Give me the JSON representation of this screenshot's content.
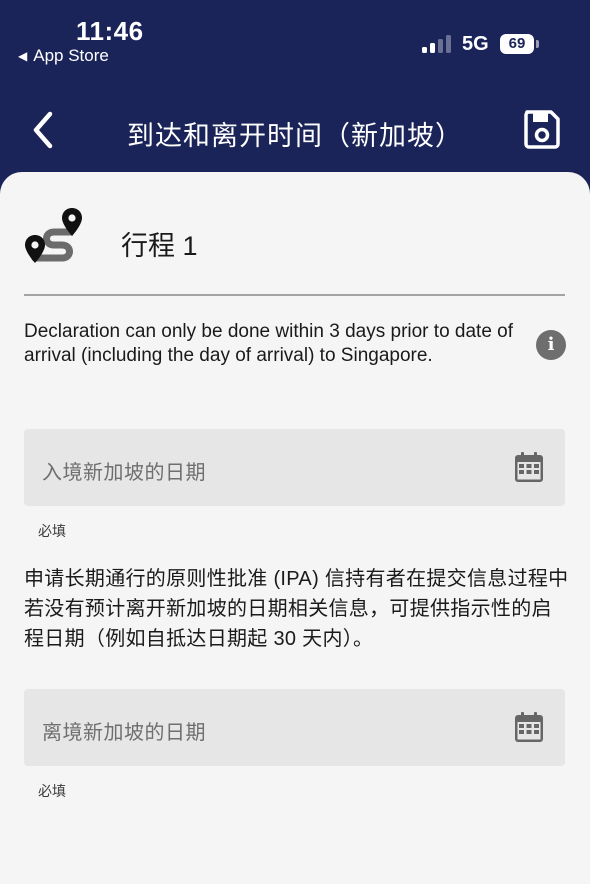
{
  "status_bar": {
    "time": "11:46",
    "back_app": "App Store",
    "network": "5G",
    "battery": "69"
  },
  "nav": {
    "title": "到达和离开时间（新加坡）",
    "back_icon": "chevron-left-icon",
    "save_icon": "floppy-disk-icon"
  },
  "trip": {
    "icon": "route-pins-icon",
    "title": "行程 1"
  },
  "info": {
    "text": "Declaration can only be done within 3 days prior to date of arrival (including the day of arrival) to Singapore.",
    "icon": "info-icon"
  },
  "arrival_field": {
    "placeholder": "入境新加坡的日期",
    "helper": "必填",
    "icon": "calendar-icon"
  },
  "note": {
    "text": "申请长期通行的原则性批准 (IPA) 信持有者在提交信息过程中若没有预计离开新加坡的日期相关信息，可提供指示性的启程日期（例如自抵达日期起 30 天内）。"
  },
  "departure_field": {
    "placeholder": "离境新加坡的日期",
    "helper": "必填",
    "icon": "calendar-icon"
  },
  "colors": {
    "header_bg": "#1b2459",
    "sheet_bg": "#f5f5f5",
    "field_bg": "#e6e6e6",
    "icon_gray": "#6e6e6e"
  }
}
